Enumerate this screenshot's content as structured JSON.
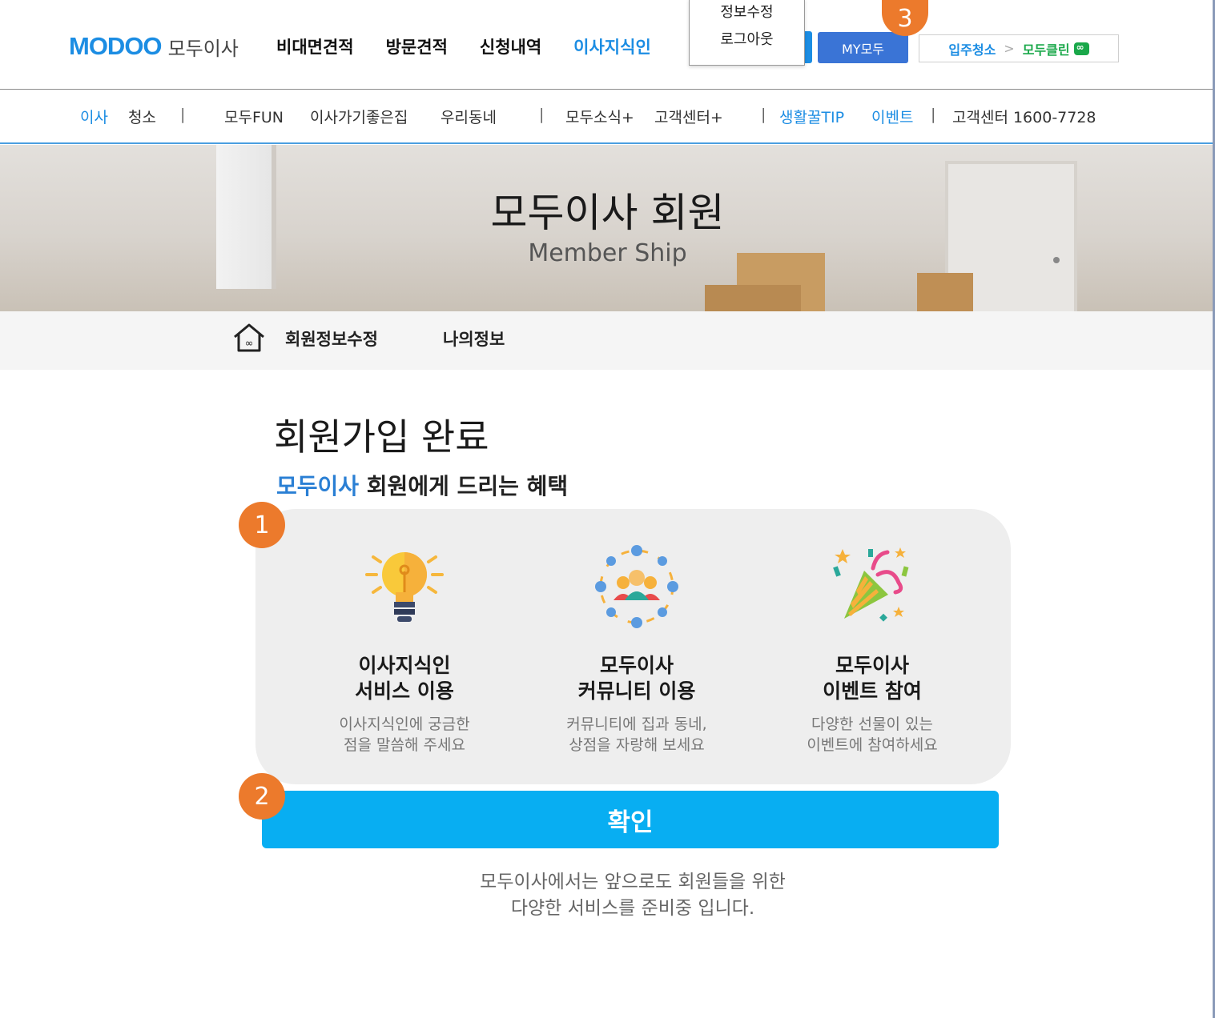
{
  "header": {
    "logo_mark": "MODOO",
    "logo_text": "모두이사",
    "nav": [
      "비대면견적",
      "방문견적",
      "신청내역",
      "이사지식인"
    ],
    "my_button": "MY모두",
    "clean_links": {
      "left": "입주청소",
      "separator": ">",
      "right": "모두클린"
    }
  },
  "dropdown": {
    "items": [
      "정보수정",
      "로그아웃"
    ]
  },
  "subnav": {
    "left": [
      "이사",
      "청소"
    ],
    "middle": [
      "모두FUN",
      "이사가기좋은집",
      "우리동네"
    ],
    "news": [
      "모두소식+",
      "고객센터+"
    ],
    "right": [
      "생활꿀TIP",
      "이벤트"
    ],
    "cs": "고객센터 1600-7728",
    "bar": "|"
  },
  "hero": {
    "title": "모두이사 회원",
    "subtitle": "Member Ship"
  },
  "breadcrumb": {
    "items": [
      "회원정보수정",
      "나의정보"
    ]
  },
  "content": {
    "title": "회원가입 완료",
    "subtitle_highlight": "모두이사",
    "subtitle_rest": " 회원에게 드리는 혜택",
    "benefits": [
      {
        "icon": "lightbulb-icon",
        "title_l1": "이사지식인",
        "title_l2": "서비스 이용",
        "desc_l1": "이사지식인에 궁금한",
        "desc_l2": "점을 말씀해 주세요"
      },
      {
        "icon": "community-icon",
        "title_l1": "모두이사",
        "title_l2": "커뮤니티 이용",
        "desc_l1": "커뮤니티에 집과 동네,",
        "desc_l2": "상점을 자랑해 보세요"
      },
      {
        "icon": "party-popper-icon",
        "title_l1": "모두이사",
        "title_l2": "이벤트 참여",
        "desc_l1": "다양한 선물이 있는",
        "desc_l2": "이벤트에 참여하세요"
      }
    ],
    "confirm_button": "확인",
    "notice_l1": "모두이사에서는 앞으로도 회원들을 위한",
    "notice_l2": "다양한 서비스를 준비중 입니다."
  },
  "badges": [
    "1",
    "2",
    "3"
  ],
  "colors": {
    "accent": "#1c8de3",
    "confirm": "#08aef2",
    "badge": "#ec7a2c",
    "clean": "#1aa84a"
  }
}
